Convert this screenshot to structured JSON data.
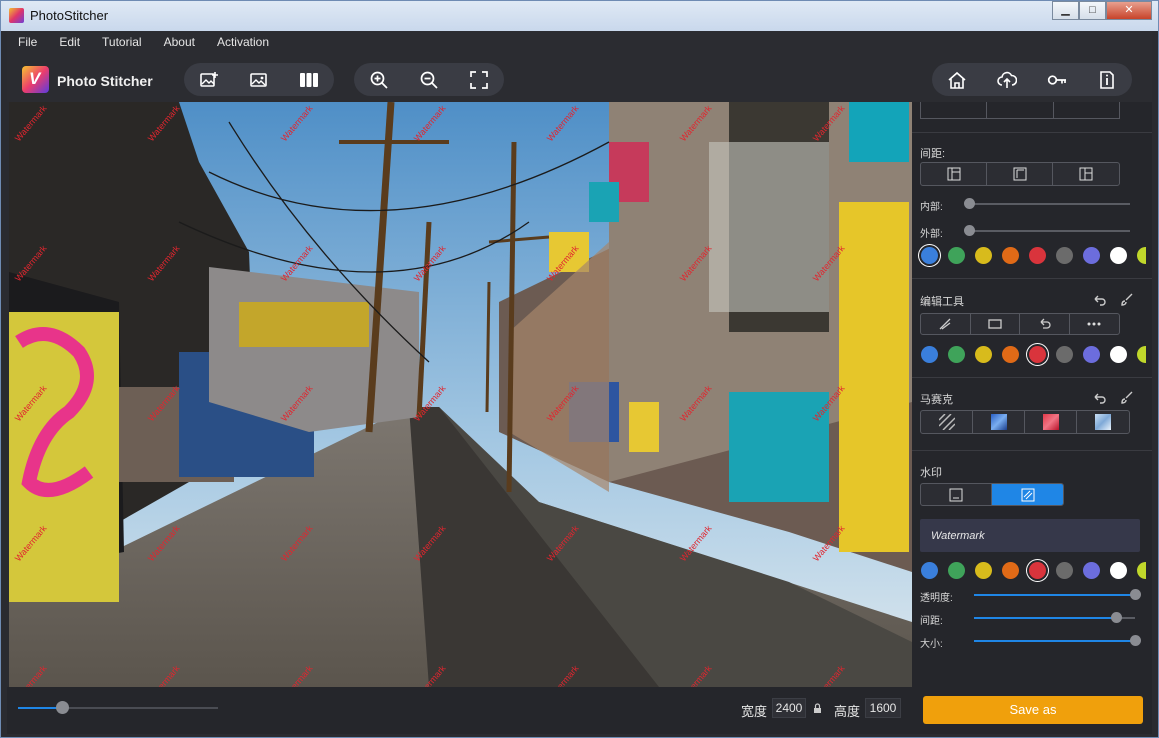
{
  "window": {
    "title": "PhotoStitcher",
    "min": "▁",
    "max": "□",
    "close": "✕"
  },
  "menu": [
    "File",
    "Edit",
    "Tutorial",
    "About",
    "Activation"
  ],
  "app": {
    "name": "Photo Stitcher"
  },
  "toolbar": {
    "left_icons": [
      "add-image-icon",
      "replace-image-icon",
      "columns-layout-icon"
    ],
    "view_icons": [
      "zoom-in-icon",
      "zoom-out-icon",
      "fit-screen-icon"
    ],
    "right_icons": [
      "home-icon",
      "upload-icon",
      "key-icon",
      "info-icon"
    ]
  },
  "canvas": {
    "watermark_text": "Watermark",
    "watermark_color": "#e0262f"
  },
  "panel": {
    "spacing": {
      "label": "间距:",
      "inner_label": "内部:",
      "outer_label": "外部:",
      "inner_value": 0,
      "outer_value": 0
    },
    "edit_tools": {
      "label": "编辑工具"
    },
    "mosaic": {
      "label": "马赛克"
    },
    "watermark": {
      "label": "水印",
      "text": "Watermark",
      "opacity_label": "透明度:",
      "spacing_label": "间距:",
      "size_label": "大小:",
      "opacity_value": 1.0,
      "spacing_value": 0.88,
      "size_value": 1.0
    },
    "colors": [
      "#3a7fdc",
      "#3fa35a",
      "#d8bb1c",
      "#e06a17",
      "#d9343c",
      "#6b6b6b",
      "#6c6ddd",
      "#ffffff",
      "#c0d72b"
    ],
    "selected_color_sets": {
      "spacing": 0,
      "edit": 4,
      "watermark": 4
    }
  },
  "bottom": {
    "zoom_value": 0.22,
    "width_label": "宽度",
    "width_value": "2400",
    "height_label": "高度",
    "height_value": "1600",
    "save_label": "Save as"
  }
}
